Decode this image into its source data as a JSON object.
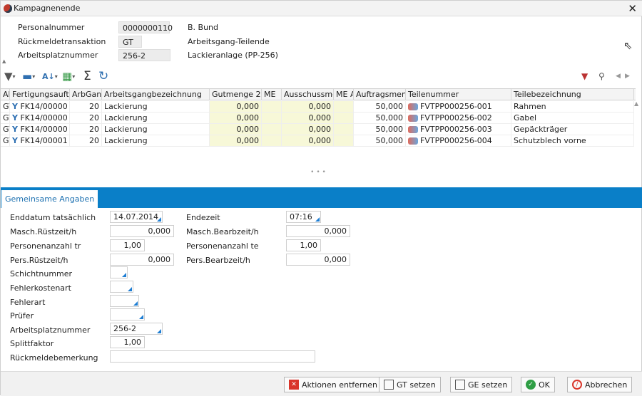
{
  "window": {
    "title": "Kampagnenende",
    "close": "✕"
  },
  "header": {
    "fields": [
      {
        "label": "Personalnummer",
        "value": "0000000110",
        "desc": "B. Bund"
      },
      {
        "label": "Rückmeldetransaktion",
        "value": "GT",
        "desc": "Arbeitsgang-Teilende"
      },
      {
        "label": "Arbeitsplatznummer",
        "value": "256-2",
        "desc": "Lackieranlage (PP-256)"
      }
    ]
  },
  "toolbar": {
    "icons": [
      "filter-icon",
      "print-icon",
      "sort-icon",
      "export-icon",
      "sum-icon",
      "refresh-icon"
    ],
    "right_icons": [
      "filter-remove-icon",
      "search-icon",
      "prev-icon",
      "next-icon"
    ]
  },
  "grid": {
    "columns": [
      "Ak",
      "Fertigungsauft",
      "ArbGan",
      "Arbeitsgangbezeichnung",
      "Gutmenge 2",
      "ME",
      "Ausschussme",
      "ME A",
      "Auftragsmen",
      "Teilenummer",
      "Teilebezeichnung"
    ],
    "rows": [
      {
        "ak": "GT",
        "auftrag": "FK14/00000",
        "arbgang": "20",
        "bez": "Lackierung",
        "gut": "0,000",
        "me": "",
        "aus": "0,000",
        "mea": "",
        "auftragsmenge": "50,000",
        "teil": "FVTPP000256-001",
        "teilbez": "Rahmen"
      },
      {
        "ak": "GT",
        "auftrag": "FK14/00000",
        "arbgang": "20",
        "bez": "Lackierung",
        "gut": "0,000",
        "me": "",
        "aus": "0,000",
        "mea": "",
        "auftragsmenge": "50,000",
        "teil": "FVTPP000256-002",
        "teilbez": "Gabel"
      },
      {
        "ak": "GT",
        "auftrag": "FK14/00000",
        "arbgang": "20",
        "bez": "Lackierung",
        "gut": "0,000",
        "me": "",
        "aus": "0,000",
        "mea": "",
        "auftragsmenge": "50,000",
        "teil": "FVTPP000256-003",
        "teilbez": "Gepäckträger"
      },
      {
        "ak": "GT",
        "auftrag": "FK14/00001",
        "arbgang": "20",
        "bez": "Lackierung",
        "gut": "0,000",
        "me": "",
        "aus": "0,000",
        "mea": "",
        "auftragsmenge": "50,000",
        "teil": "FVTPP000256-004",
        "teilbez": "Schutzblech vorne"
      }
    ]
  },
  "tabs": {
    "active": "Gemeinsame Angaben"
  },
  "form": {
    "enddatum_label": "Enddatum tatsächlich",
    "enddatum": "14.07.2014",
    "endezeit_label": "Endezeit",
    "endezeit": "07:16",
    "masch_ruest_label": "Masch.Rüstzeit/h",
    "masch_ruest": "0,000",
    "masch_bearb_label": "Masch.Bearbzeit/h",
    "masch_bearb": "0,000",
    "pers_anz_tr_label": "Personenanzahl  tr",
    "pers_anz_tr": "1,00",
    "pers_anz_te_label": "Personenanzahl  te",
    "pers_anz_te": "1,00",
    "pers_ruest_label": "Pers.Rüstzeit/h",
    "pers_ruest": "0,000",
    "pers_bearb_label": "Pers.Bearbzeit/h",
    "pers_bearb": "0,000",
    "schicht_label": "Schichtnummer",
    "schicht": "",
    "fehlerkosten_label": "Fehlerkostenart",
    "fehlerkosten": "",
    "fehlerart_label": "Fehlerart",
    "fehlerart": "",
    "pruefer_label": "Prüfer",
    "pruefer": "",
    "arbplatz_label": "Arbeitsplatznummer",
    "arbplatz": "256-2",
    "split_label": "Splittfaktor",
    "split": "1,00",
    "bemerkung_label": "Rückmeldebemerkung",
    "bemerkung": ""
  },
  "buttons": {
    "aktionen": "Aktionen entfernen",
    "gt": "GT setzen",
    "ge": "GE setzen",
    "ok": "OK",
    "abbrechen": "Abbrechen"
  },
  "colors": {
    "accent": "#0a7fc8",
    "remove": "#d9352a",
    "ok": "#2f9e45",
    "cancel": "#d9352a"
  }
}
